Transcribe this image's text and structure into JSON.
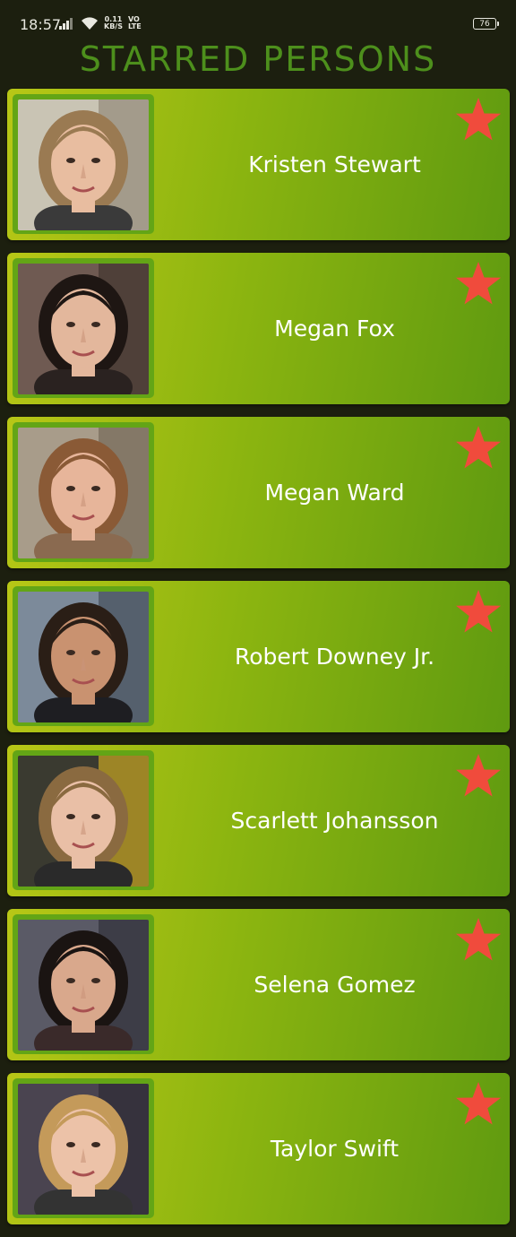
{
  "status": {
    "time": "18:57",
    "speed_value": "0.11",
    "speed_unit": "KB/S",
    "volte_top": "VO",
    "volte_bottom": "LTE",
    "battery": "76"
  },
  "title": "STARRED PERSONS",
  "colors": {
    "title": "#4d8f1c",
    "star": "#f04b3c",
    "card_gradient_start": "#b8c716",
    "card_gradient_end": "#5f9a10"
  },
  "persons": [
    {
      "name": "Kristen Stewart",
      "starred": true
    },
    {
      "name": "Megan Fox",
      "starred": true
    },
    {
      "name": "Megan Ward",
      "starred": true
    },
    {
      "name": "Robert Downey Jr.",
      "starred": true
    },
    {
      "name": "Scarlett Johansson",
      "starred": true
    },
    {
      "name": "Selena Gomez",
      "starred": true
    },
    {
      "name": "Taylor Swift",
      "starred": true
    }
  ]
}
